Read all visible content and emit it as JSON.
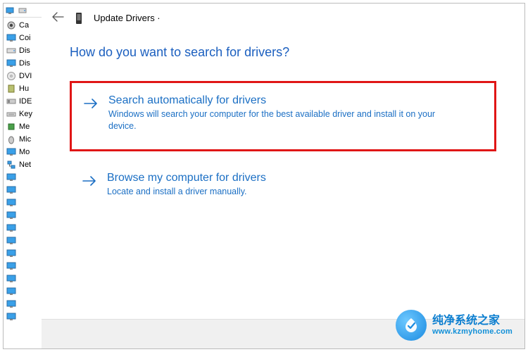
{
  "deviceManager": {
    "toolbar": {
      "icon1": "computer-icon",
      "icon2": "drive-icon"
    },
    "items": [
      {
        "icon": "camera",
        "label": "Ca"
      },
      {
        "icon": "monitor",
        "label": "Coi"
      },
      {
        "icon": "drive",
        "label": "Dis"
      },
      {
        "icon": "monitor",
        "label": "Dis"
      },
      {
        "icon": "disc",
        "label": "DVI"
      },
      {
        "icon": "usb",
        "label": "Hu"
      },
      {
        "icon": "ide",
        "label": "IDE"
      },
      {
        "icon": "keyboard",
        "label": "Key"
      },
      {
        "icon": "chip",
        "label": "Me"
      },
      {
        "icon": "mouse",
        "label": "Mic"
      },
      {
        "icon": "monitor",
        "label": "Mo"
      },
      {
        "icon": "network",
        "label": "Net"
      },
      {
        "icon": "monitor",
        "label": ""
      },
      {
        "icon": "monitor",
        "label": ""
      },
      {
        "icon": "monitor",
        "label": ""
      },
      {
        "icon": "monitor",
        "label": ""
      },
      {
        "icon": "monitor",
        "label": ""
      },
      {
        "icon": "monitor",
        "label": ""
      },
      {
        "icon": "monitor",
        "label": ""
      },
      {
        "icon": "monitor",
        "label": ""
      },
      {
        "icon": "monitor",
        "label": ""
      },
      {
        "icon": "monitor",
        "label": ""
      },
      {
        "icon": "monitor",
        "label": ""
      },
      {
        "icon": "monitor",
        "label": ""
      }
    ]
  },
  "dialog": {
    "title": "Update Drivers ·",
    "question": "How do you want to search for drivers?",
    "options": [
      {
        "title": "Search automatically for drivers",
        "desc": "Windows will search your computer for the best available driver and install it on your device.",
        "highlighted": true
      },
      {
        "title": "Browse my computer for drivers",
        "desc": "Locate and install a driver manually.",
        "highlighted": false
      }
    ]
  },
  "watermark": {
    "line1": "纯净系统之家",
    "line2": "www.kzmyhome.com"
  },
  "colors": {
    "link": "#1b6fc4",
    "highlight_border": "#e01616"
  }
}
